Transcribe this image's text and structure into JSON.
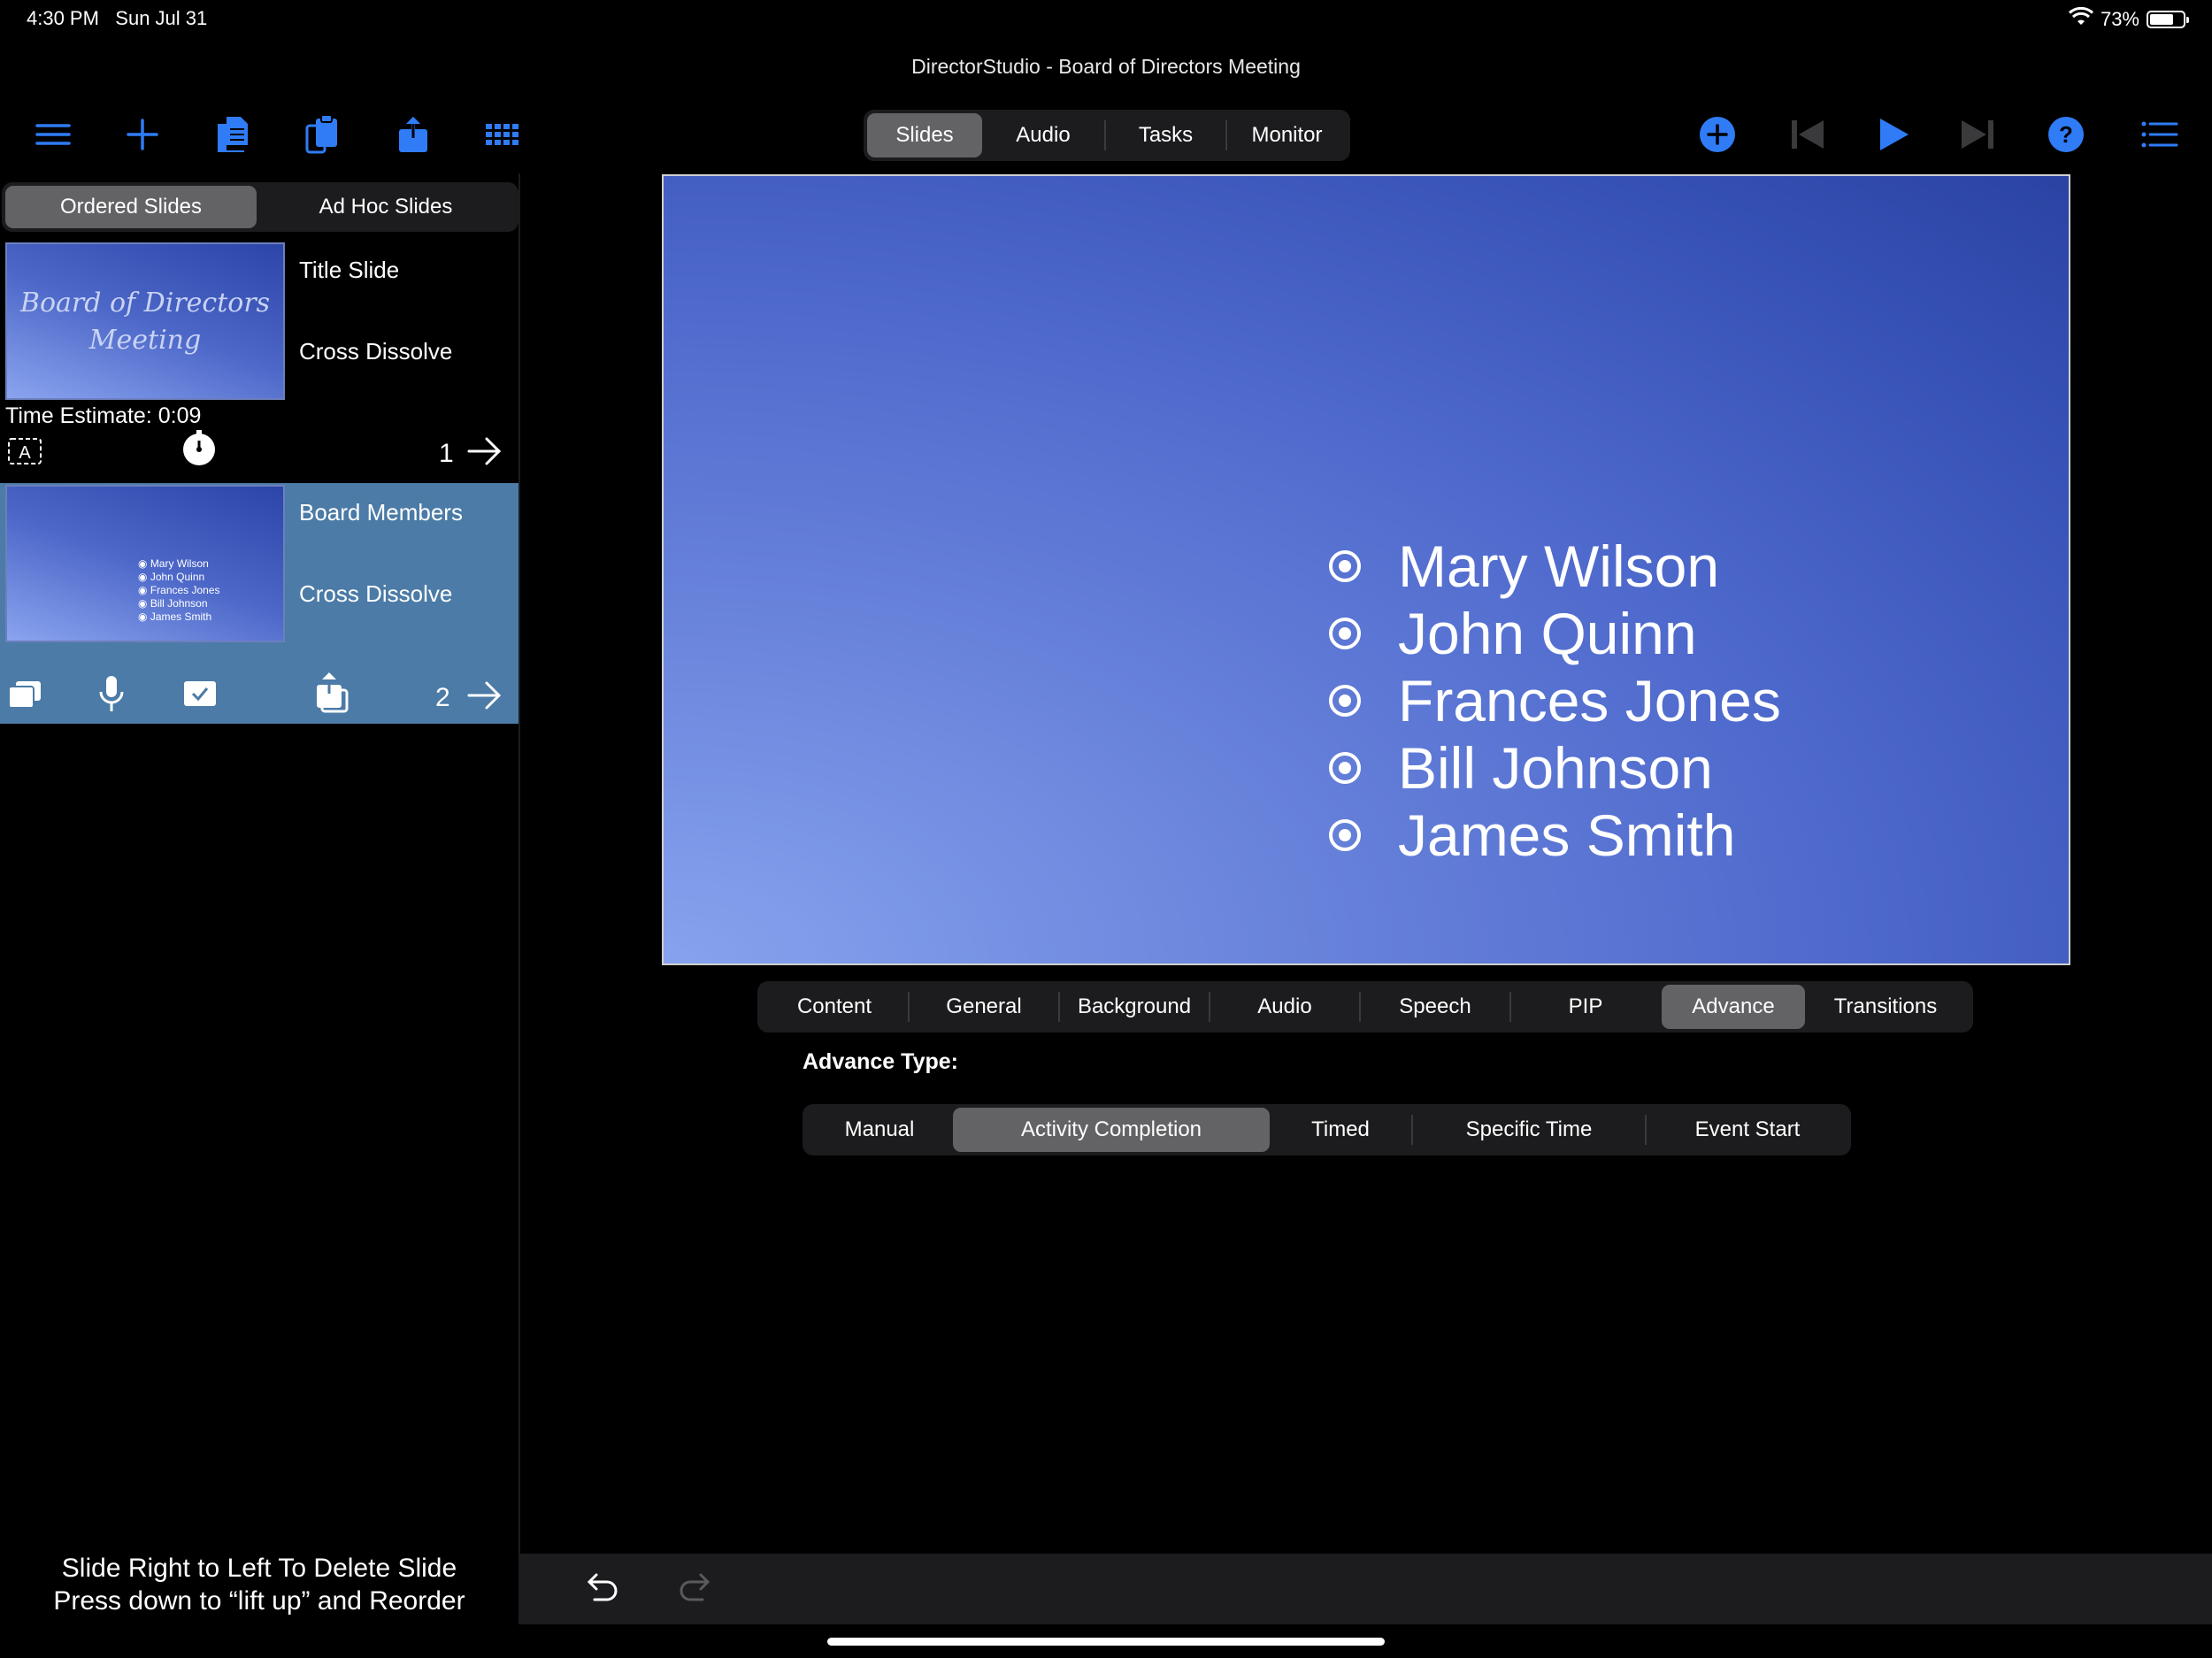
{
  "status": {
    "time": "4:30 PM",
    "date": "Sun Jul 31",
    "battery": "73%",
    "battery_level": 0.73
  },
  "app": {
    "title": "DirectorStudio - Board of Directors Meeting"
  },
  "toolbar": {
    "left_icons": [
      "menu-icon",
      "plus-icon",
      "documents-icon",
      "clipboard-icon",
      "share-icon",
      "grid-icon"
    ],
    "right_icons": [
      "add-circle-icon",
      "skip-back-icon",
      "play-icon",
      "skip-forward-icon",
      "help-icon",
      "list-icon"
    ],
    "accent": "#2f7cf6"
  },
  "main_tabs": {
    "items": [
      "Slides",
      "Audio",
      "Tasks",
      "Monitor"
    ],
    "selected": "Slides"
  },
  "sidebar": {
    "tabs": [
      "Ordered Slides",
      "Ad Hoc Slides"
    ],
    "selected_tab": "Ordered Slides",
    "slides": [
      {
        "name": "Title Slide",
        "transition": "Cross Dissolve",
        "time_estimate": "Time Estimate: 0:09",
        "number": "1",
        "thumb_text": "Board of Directors Meeting"
      },
      {
        "name": "Board Members",
        "transition": "Cross Dissolve",
        "number": "2",
        "thumb_items": [
          "Mary Wilson",
          "John Quinn",
          "Frances Jones",
          "Bill Johnson",
          "James Smith"
        ],
        "selected": true,
        "highlight": "#4b7ba6"
      }
    ],
    "hint_line1": "Slide Right to Left To Delete Slide",
    "hint_line2": "Press down to “lift up” and Reorder"
  },
  "preview": {
    "bullets": [
      "Mary Wilson",
      "John Quinn",
      "Frances Jones",
      "Bill Johnson",
      "James Smith"
    ]
  },
  "property_tabs": {
    "items": [
      "Content",
      "General",
      "Background",
      "Audio",
      "Speech",
      "PIP",
      "Advance",
      "Transitions"
    ],
    "selected": "Advance"
  },
  "advance": {
    "label": "Advance Type:",
    "options": [
      "Manual",
      "Activity Completion",
      "Timed",
      "Specific Time",
      "Event Start"
    ],
    "selected": "Activity Completion"
  }
}
